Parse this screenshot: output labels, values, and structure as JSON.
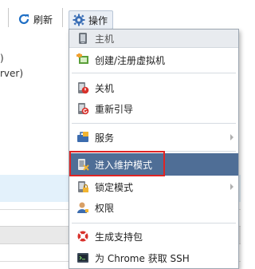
{
  "toolbar": {
    "refresh_label": "刷新",
    "actions_label": "操作"
  },
  "background": {
    "line1": ")",
    "line2": "rver)"
  },
  "menu": {
    "header": {
      "label": "主机",
      "icon": "host-icon"
    },
    "items": [
      {
        "label": "创建/注册虚拟机",
        "icon": "register-vm-icon"
      },
      {
        "label": "关机",
        "icon": "shutdown-icon"
      },
      {
        "label": "重新引导",
        "icon": "reboot-icon"
      },
      {
        "label": "服务",
        "icon": "services-icon",
        "submenu": true
      },
      {
        "label": "进入维护模式",
        "icon": "maintenance-icon",
        "highlighted": true
      },
      {
        "label": "锁定模式",
        "icon": "lockdown-icon",
        "submenu": true
      },
      {
        "label": "权限",
        "icon": "permissions-icon"
      },
      {
        "label": "生成支持包",
        "icon": "support-bundle-icon"
      },
      {
        "label": "为 Chrome 获取 SSH",
        "icon": "ssh-console-icon"
      }
    ]
  },
  "colors": {
    "highlight_bg": "#4f6e96",
    "annotation_border": "#e02424",
    "selected_row_bg": "#e3f1fb"
  }
}
